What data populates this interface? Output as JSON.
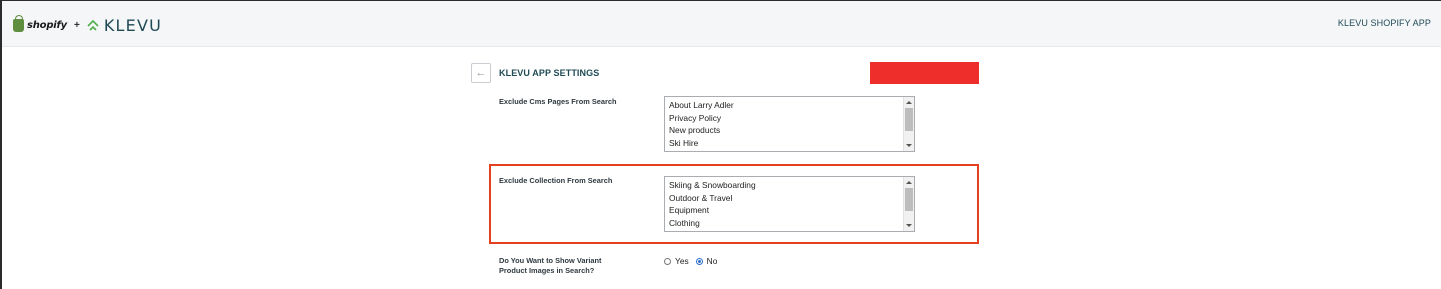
{
  "header": {
    "shopify_text": "shopify",
    "plus": "+",
    "klevu_text": "KLEVU",
    "app_link": "KLEVU SHOPIFY APP"
  },
  "page": {
    "back_arrow": "←",
    "title": "KLEVU APP SETTINGS"
  },
  "settings": {
    "exclude_cms": {
      "label": "Exclude Cms Pages From Search",
      "options": [
        "About Larry Adler",
        "Privacy Policy",
        "New products",
        "Ski Hire"
      ]
    },
    "exclude_collection": {
      "label": "Exclude Collection From Search",
      "options": [
        "Skiing & Snowboarding",
        "Outdoor & Travel",
        "Equipment",
        "Clothing"
      ]
    },
    "variant_images": {
      "label_line1": "Do You Want to Show Variant",
      "label_line2": "Product Images in Search?",
      "options": [
        "Yes",
        "No"
      ],
      "selected": "No"
    }
  },
  "colors": {
    "brand_teal": "#1f4a54",
    "shopify_green": "#5e8e3e",
    "redaction_red": "#ee2e2b",
    "highlight_orange": "#e3401f",
    "radio_blue": "#2d6fcc"
  }
}
